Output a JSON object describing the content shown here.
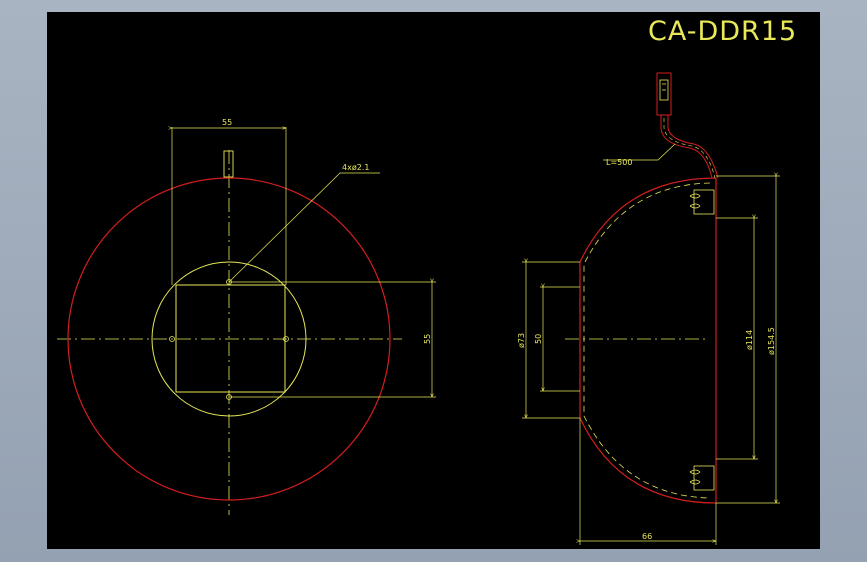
{
  "title_block": {
    "drawing_id": "CA-DDR15"
  },
  "colors": {
    "background": "#000000",
    "outline": "#d21e1e",
    "dimension": "#e8e85a",
    "frame": "#9ba6b4"
  },
  "front_view": {
    "dim_square_width": "55",
    "dim_square_height": "55",
    "hole_callout": "4xø2.1"
  },
  "side_view": {
    "cable_length": "L=500",
    "dim_outer_dia": "ø154.5",
    "dim_inner_dia": "ø114",
    "dim_opening_dia": "ø73",
    "dim_window": "50",
    "dim_depth": "66"
  }
}
